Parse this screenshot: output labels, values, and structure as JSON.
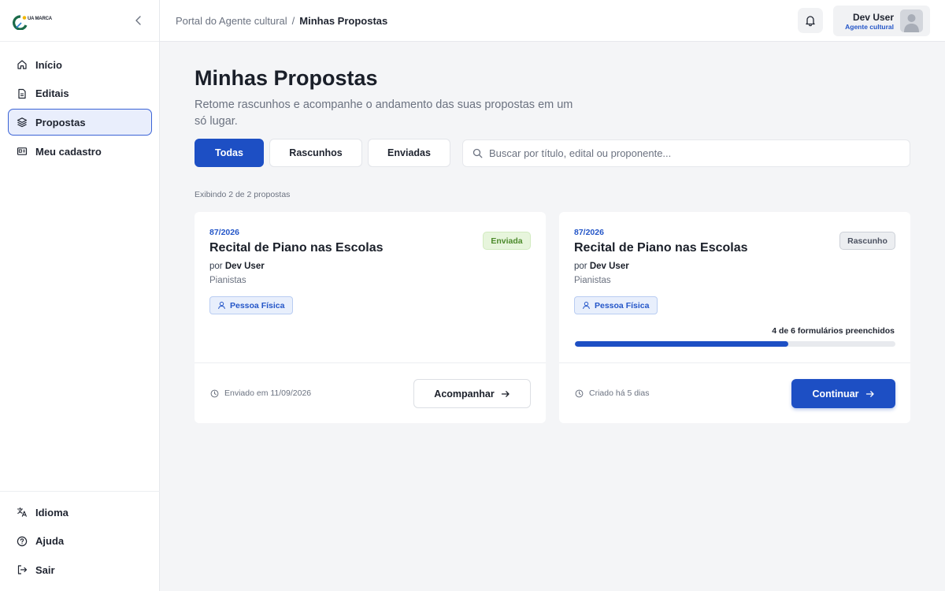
{
  "brand": {
    "logo_text": "UA MARCA"
  },
  "colors": {
    "accent": "#1d4fc4",
    "link": "#2456c8",
    "sent_bg": "#e7f5dc",
    "sent_text": "#4c8a2b"
  },
  "sidebar": {
    "items": [
      {
        "label": "Início",
        "icon": "home-icon",
        "active": false
      },
      {
        "label": "Editais",
        "icon": "document-icon",
        "active": false
      },
      {
        "label": "Propostas",
        "icon": "layers-icon",
        "active": true
      },
      {
        "label": "Meu cadastro",
        "icon": "id-card-icon",
        "active": false
      }
    ],
    "bottom_items": [
      {
        "label": "Idioma",
        "icon": "translate-icon"
      },
      {
        "label": "Ajuda",
        "icon": "help-circle-icon"
      },
      {
        "label": "Sair",
        "icon": "logout-icon"
      }
    ]
  },
  "header": {
    "breadcrumb": {
      "parent": "Portal do Agente cultural",
      "separator": "/",
      "current": "Minhas Propostas"
    },
    "user": {
      "name": "Dev User",
      "role": "Agente cultural"
    }
  },
  "main": {
    "title": "Minhas Propostas",
    "subtitle": "Retome rascunhos e acompanhe o andamento das suas propostas em um só lugar.",
    "tabs": [
      {
        "label": "Todas",
        "active": true
      },
      {
        "label": "Rascunhos",
        "active": false
      },
      {
        "label": "Enviadas",
        "active": false
      }
    ],
    "search": {
      "placeholder": "Buscar por título, edital ou proponente...",
      "value": ""
    },
    "count_text": "Exibindo 2 de 2 propostas",
    "cards": [
      {
        "code": "87/2026",
        "title": "Recital de Piano nas Escolas",
        "author_prefix": "por",
        "author": "Dev User",
        "category": "Pianistas",
        "type": "Pessoa Física",
        "status": "Enviada",
        "footer_text": "Enviado em 11/09/2026",
        "action": "Acompanhar"
      },
      {
        "code": "87/2026",
        "title": "Recital de Piano nas Escolas",
        "author_prefix": "por",
        "author": "Dev User",
        "category": "Pianistas",
        "type": "Pessoa Física",
        "status": "Rascunho",
        "progress_text": "4 de 6 formulários preenchidos",
        "progress_done": 4,
        "progress_total": 6,
        "footer_text": "Criado há 5 dias",
        "action": "Continuar"
      }
    ]
  }
}
